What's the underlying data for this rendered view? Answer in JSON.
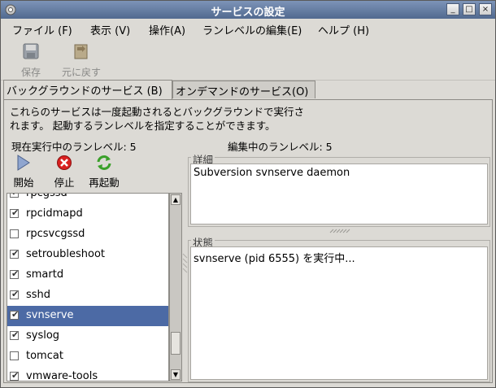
{
  "window": {
    "title": "サービスの設定"
  },
  "window_buttons": [
    "_",
    "□",
    "×"
  ],
  "menubar": {
    "items": [
      {
        "label": "ファイル (F)"
      },
      {
        "label": "表示 (V)"
      },
      {
        "label": "操作(A)"
      },
      {
        "label": "ランレベルの編集(E)"
      },
      {
        "label": "ヘルプ (H)"
      }
    ]
  },
  "toolbar": {
    "save_label": "保存",
    "revert_label": "元に戻す"
  },
  "tabs": [
    {
      "label": "バックグラウンドのサービス (B)"
    },
    {
      "label": "オンデマンドのサービス(O)"
    }
  ],
  "description": {
    "line1": "これらのサービスは一度起動されるとバックグラウンドで実行さ",
    "line2": "れます。 起動するランレベルを指定することができます。"
  },
  "runlevel": {
    "current": "現在実行中のランレベル: 5",
    "editing": "編集中のランレベル: 5"
  },
  "actions": {
    "start_label": "開始",
    "stop_label": "停止",
    "restart_label": "再起動"
  },
  "services": [
    {
      "name": "rpcgssd",
      "checked": true
    },
    {
      "name": "rpcidmapd",
      "checked": true
    },
    {
      "name": "rpcsvcgssd",
      "checked": false
    },
    {
      "name": "setroubleshoot",
      "checked": true
    },
    {
      "name": "smartd",
      "checked": true
    },
    {
      "name": "sshd",
      "checked": true
    },
    {
      "name": "svnserve",
      "checked": true,
      "selected": true
    },
    {
      "name": "syslog",
      "checked": true
    },
    {
      "name": "tomcat",
      "checked": false
    },
    {
      "name": "vmware-tools",
      "checked": true
    }
  ],
  "details": {
    "label": "詳細",
    "text": "Subversion svnserve daemon"
  },
  "status": {
    "label": "状態",
    "text": "svnserve (pid 6555) を実行中..."
  },
  "colors": {
    "titlebar": "#51698f",
    "selection": "#4c6aa5",
    "background": "#dcdad5"
  }
}
